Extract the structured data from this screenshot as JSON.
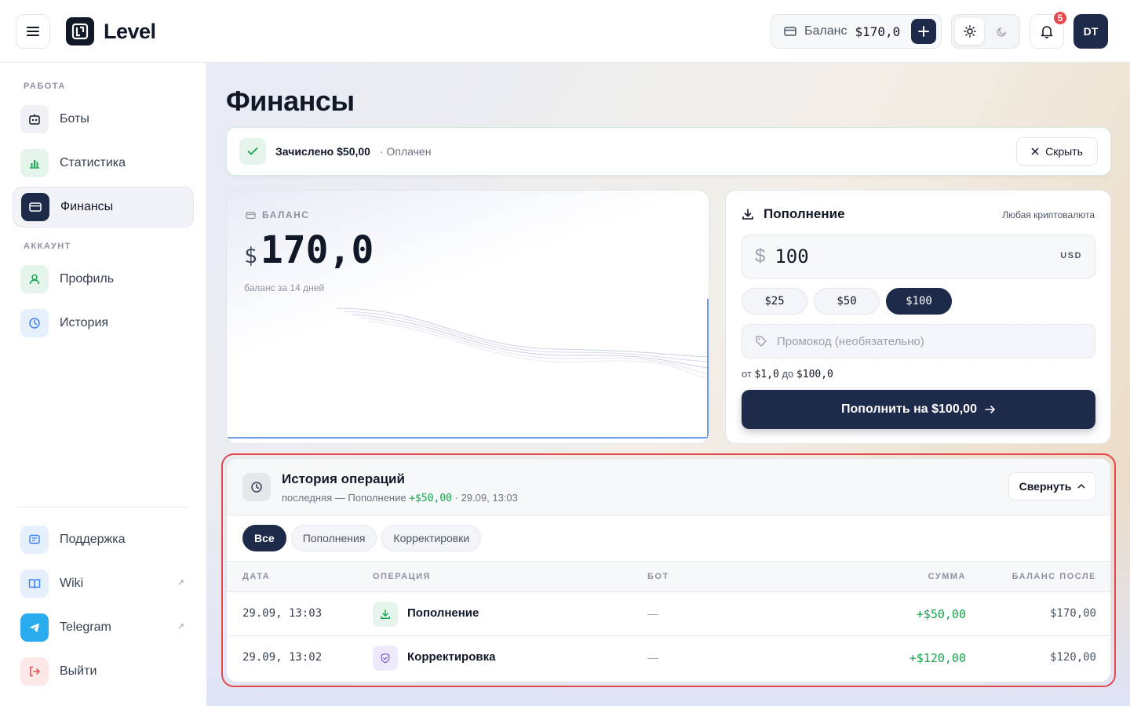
{
  "header": {
    "logo_text": "Level",
    "balance_label": "Баланс",
    "balance_value": "$170,0",
    "notifications_count": "5",
    "avatar_initials": "DT"
  },
  "sidebar": {
    "section_work": "РАБОТА",
    "section_account": "АККАУНТ",
    "items": [
      {
        "label": "Боты",
        "icon": "bot-icon"
      },
      {
        "label": "Статистика",
        "icon": "bar-chart-icon"
      },
      {
        "label": "Финансы",
        "icon": "wallet-icon",
        "active": true
      },
      {
        "label": "Профиль",
        "icon": "user-icon"
      },
      {
        "label": "История",
        "icon": "clock-icon"
      }
    ],
    "bottom_items": [
      {
        "label": "Поддержка",
        "icon": "message-icon"
      },
      {
        "label": "Wiki",
        "icon": "book-icon",
        "external": true
      },
      {
        "label": "Telegram",
        "icon": "telegram-icon",
        "external": true
      },
      {
        "label": "Выйти",
        "icon": "logout-icon"
      }
    ]
  },
  "page": {
    "title": "Финансы"
  },
  "notice": {
    "text": "Зачислено $50,00",
    "status": "· Оплачен",
    "hide_label": "Скрыть"
  },
  "balance_card": {
    "label": "БАЛАНС",
    "currency": "$",
    "amount": "170,0",
    "subtitle": "баланс за 14 дней"
  },
  "topup": {
    "title": "Пополнение",
    "note": "Любая криптовалюта",
    "currency_symbol": "$",
    "amount": "100",
    "currency_code": "USD",
    "presets": [
      "$25",
      "$50",
      "$100"
    ],
    "selected_preset": "$100",
    "promo_placeholder": "Промокод (необязательно)",
    "range_from_label": "от",
    "range_from": "$1,0",
    "range_to_label": "до",
    "range_to": "$100,0",
    "submit_label": "Пополнить на $100,00"
  },
  "history": {
    "title": "История операций",
    "last_prefix": "последняя — Пополнение",
    "last_amount": "+$50,00",
    "last_time": "· 29.09, 13:03",
    "collapse_label": "Свернуть",
    "filters": [
      "Все",
      "Пополнения",
      "Корректировки"
    ],
    "active_filter": "Все",
    "columns": [
      "ДАТА",
      "ОПЕРАЦИЯ",
      "БОТ",
      "СУММА",
      "БАЛАНС ПОСЛЕ"
    ],
    "rows": [
      {
        "date": "29.09, 13:03",
        "operation": "Пополнение",
        "icon": "download-icon",
        "bot": "—",
        "amount": "+$50,00",
        "balance_after": "$170,00"
      },
      {
        "date": "29.09, 13:02",
        "operation": "Корректировка",
        "icon": "shield-check-icon",
        "bot": "—",
        "amount": "+$120,00",
        "balance_after": "$120,00"
      }
    ]
  },
  "colors": {
    "accent": "#1e2a4a",
    "positive": "#16a34a",
    "highlight_border": "#e5484d",
    "badge": "#e5484d"
  }
}
